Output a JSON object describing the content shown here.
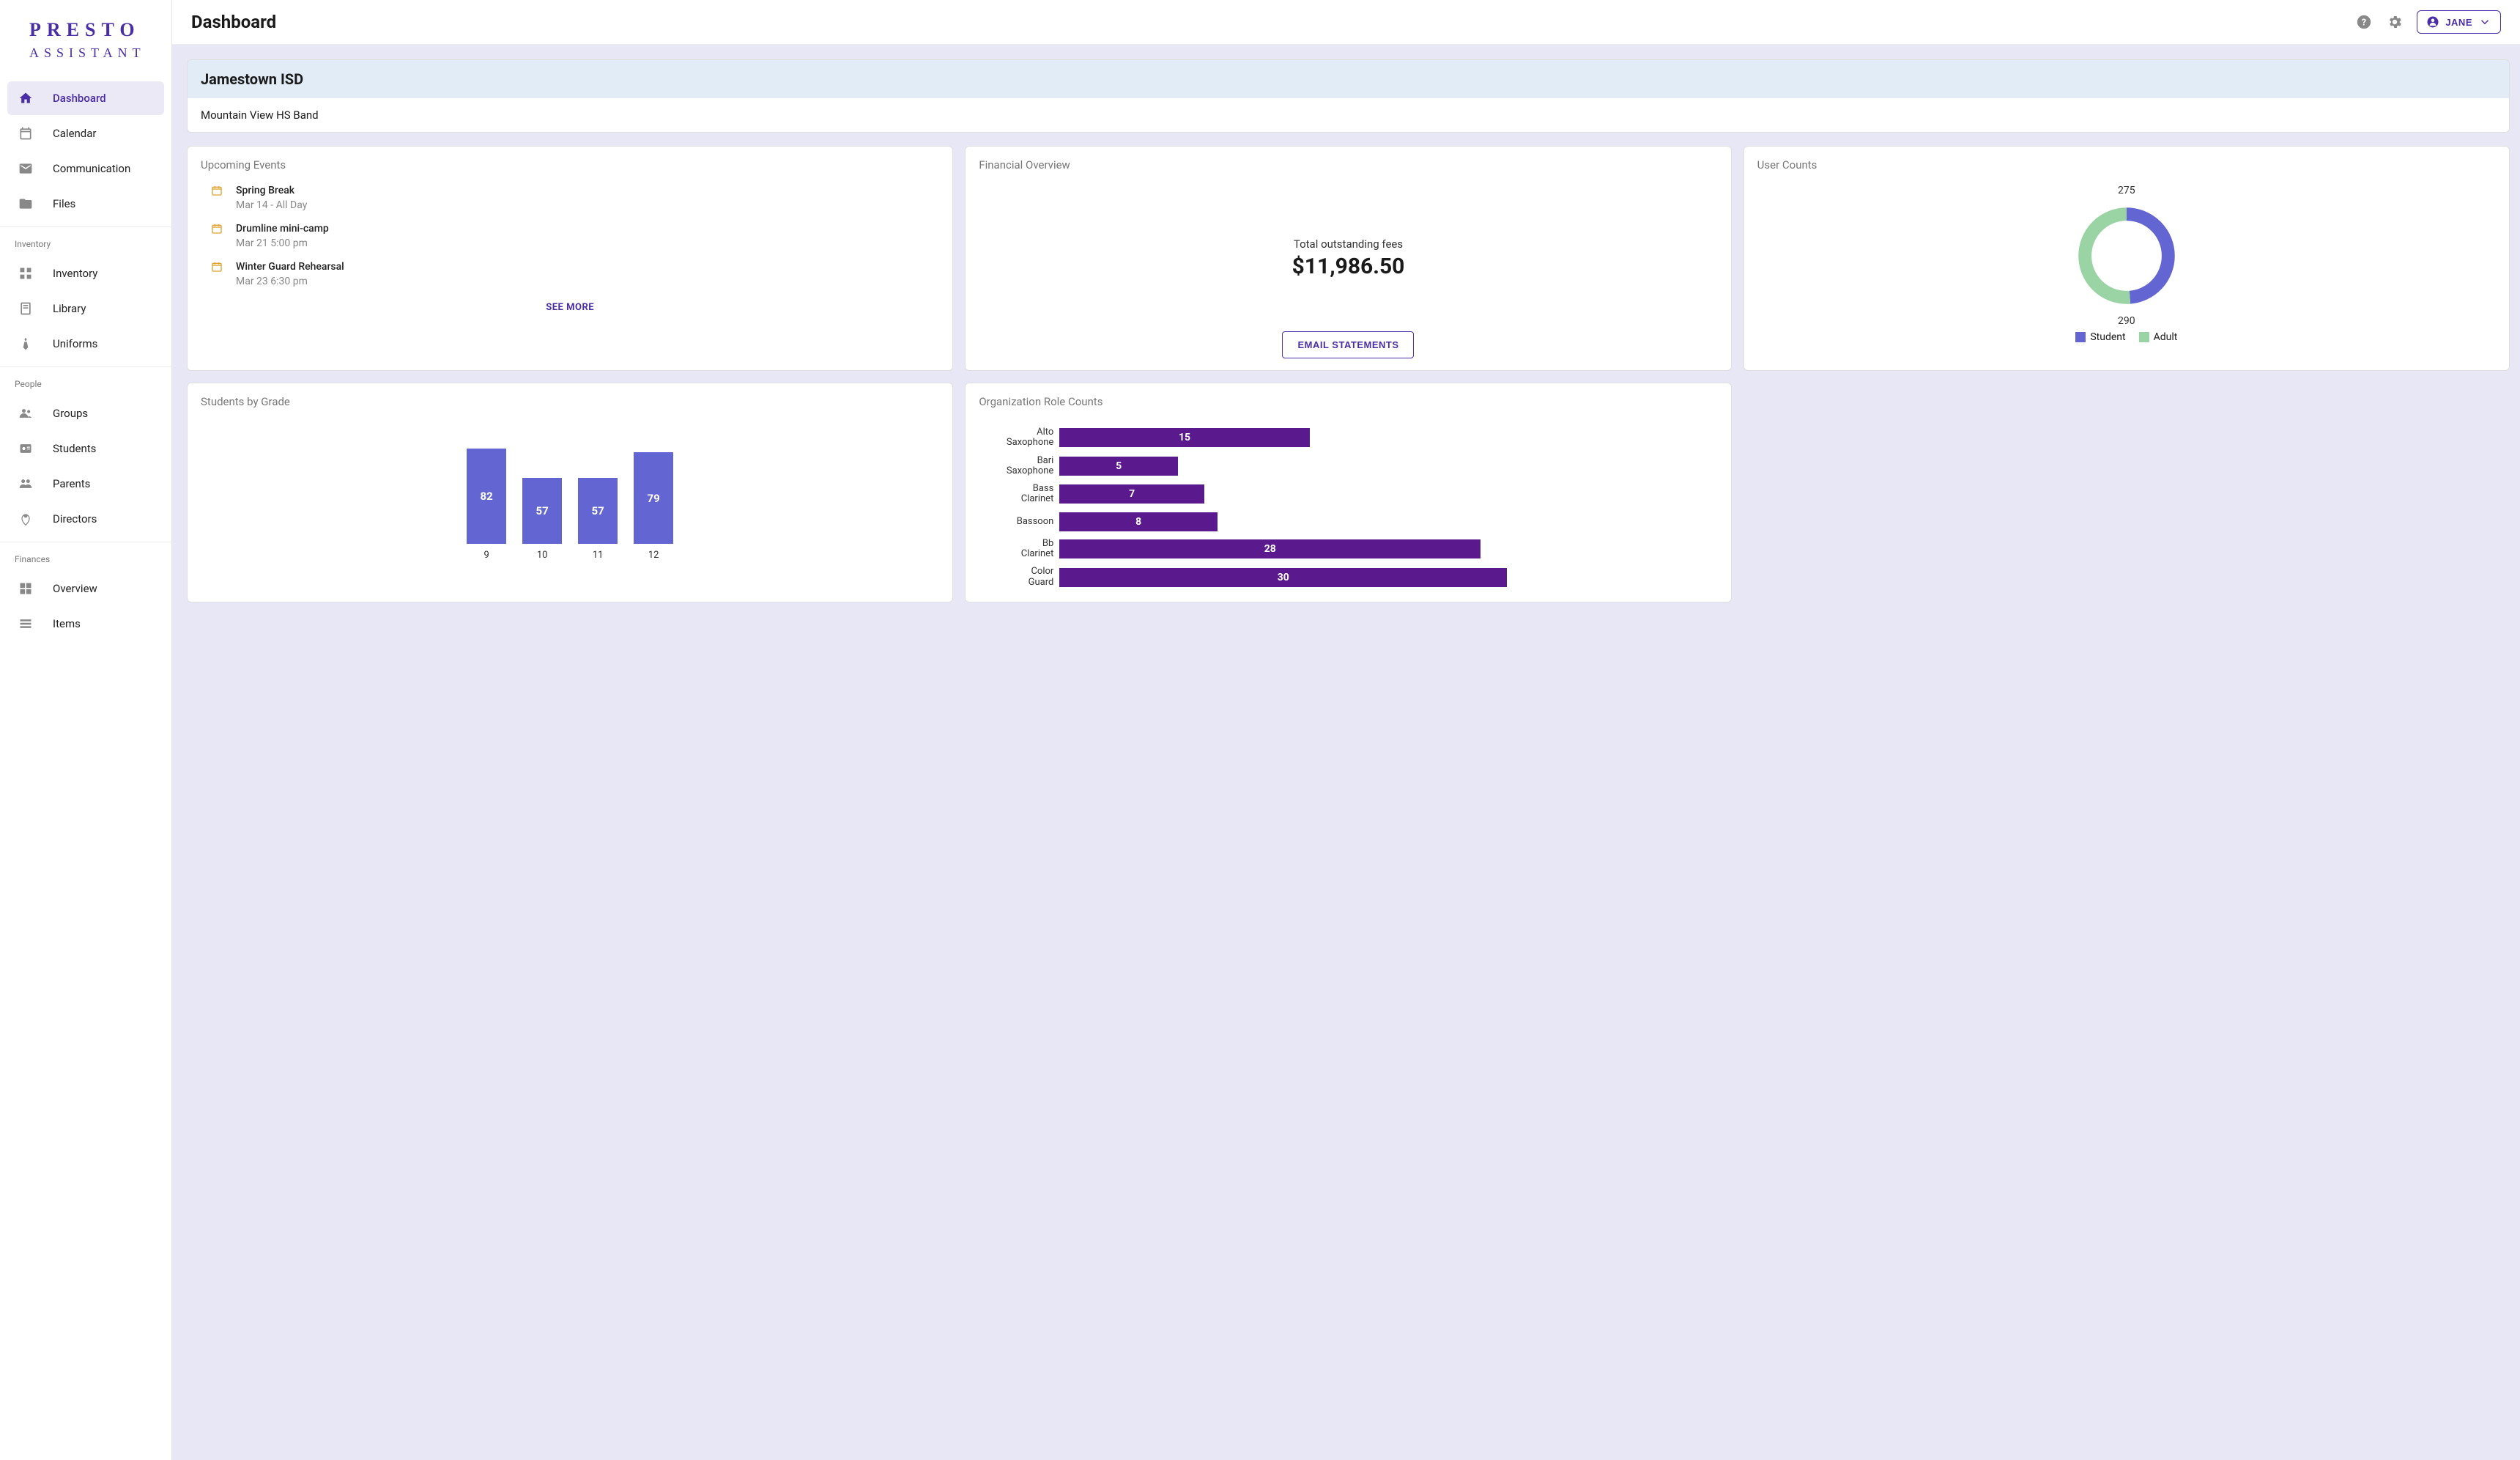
{
  "logo": {
    "main": "PRESTO",
    "sub": "ASSISTANT"
  },
  "sidebar": {
    "groups": [
      {
        "title": "",
        "items": [
          {
            "label": "Dashboard",
            "icon": "home",
            "active": true
          },
          {
            "label": "Calendar",
            "icon": "calendar"
          },
          {
            "label": "Communication",
            "icon": "mail"
          },
          {
            "label": "Files",
            "icon": "folder"
          }
        ]
      },
      {
        "title": "Inventory",
        "items": [
          {
            "label": "Inventory",
            "icon": "boxes"
          },
          {
            "label": "Library",
            "icon": "book"
          },
          {
            "label": "Uniforms",
            "icon": "tie"
          }
        ]
      },
      {
        "title": "People",
        "items": [
          {
            "label": "Groups",
            "icon": "group"
          },
          {
            "label": "Students",
            "icon": "badge"
          },
          {
            "label": "Parents",
            "icon": "people"
          },
          {
            "label": "Directors",
            "icon": "person-pin"
          }
        ]
      },
      {
        "title": "Finances",
        "items": [
          {
            "label": "Overview",
            "icon": "grid"
          },
          {
            "label": "Items",
            "icon": "list"
          }
        ]
      }
    ]
  },
  "page_title": "Dashboard",
  "user": {
    "name": "JANE"
  },
  "org": {
    "district": "Jamestown ISD",
    "program": "Mountain View HS Band"
  },
  "cards": {
    "events": {
      "title": "Upcoming Events",
      "items": [
        {
          "title": "Spring Break",
          "when": "Mar 14 - All Day"
        },
        {
          "title": "Drumline mini-camp",
          "when": "Mar 21 5:00 pm"
        },
        {
          "title": "Winter Guard Rehearsal",
          "when": "Mar 23 6:30 pm"
        }
      ],
      "see_more": "SEE MORE"
    },
    "financial": {
      "title": "Financial Overview",
      "label": "Total outstanding fees",
      "value": "$11,986.50",
      "button": "EMAIL STATEMENTS"
    },
    "user_counts": {
      "title": "User Counts",
      "student_label": "Student",
      "adult_label": "Adult",
      "student_count": "275",
      "adult_count": "290"
    },
    "students_by_grade": {
      "title": "Students by Grade"
    },
    "role_counts": {
      "title": "Organization Role Counts"
    }
  },
  "chart_data": [
    {
      "id": "user_counts_donut",
      "type": "pie",
      "series": [
        {
          "name": "Student",
          "value": 275,
          "color": "#6366d2"
        },
        {
          "name": "Adult",
          "value": 290,
          "color": "#9ad3a4"
        }
      ]
    },
    {
      "id": "students_by_grade",
      "type": "bar",
      "categories": [
        "9",
        "10",
        "11",
        "12"
      ],
      "values": [
        82,
        57,
        57,
        79
      ],
      "color": "#6366d2"
    },
    {
      "id": "organization_role_counts",
      "type": "bar",
      "orientation": "horizontal",
      "categories": [
        "Alto Saxophone",
        "Bari Saxophone",
        "Bass Clarinet",
        "Bassoon",
        "Bb Clarinet",
        "Color Guard"
      ],
      "values": [
        15,
        5,
        7,
        8,
        28,
        30
      ],
      "color": "#5a198c"
    }
  ]
}
